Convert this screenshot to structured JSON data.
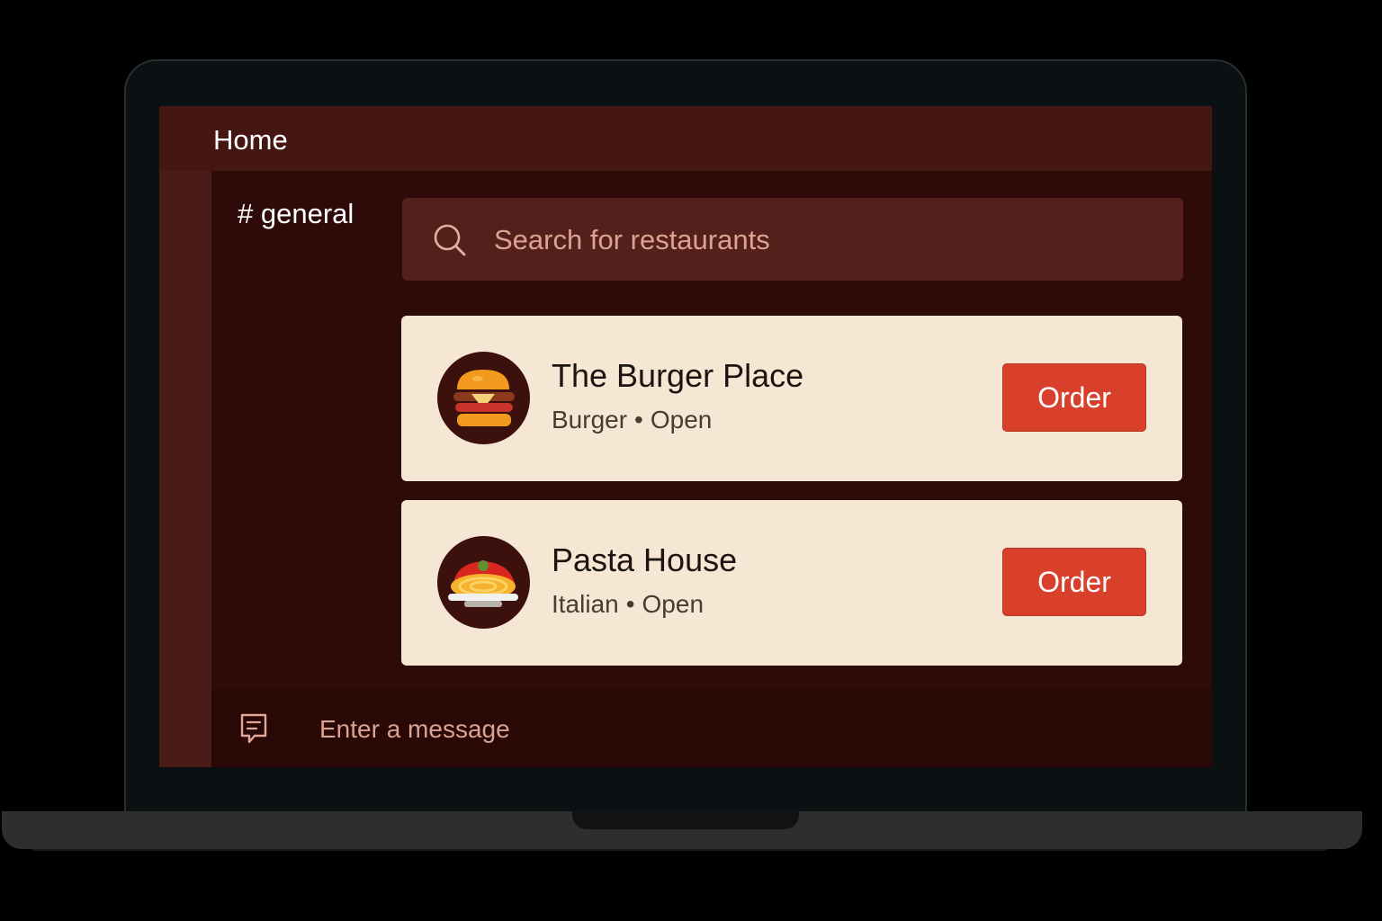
{
  "header": {
    "title": "Home"
  },
  "channel": {
    "label": "# general"
  },
  "search": {
    "placeholder": "Search for restaurants",
    "icon": "search-icon"
  },
  "restaurants": [
    {
      "name": "The Burger Place",
      "category": "Burger",
      "status": "Open",
      "action": "Order",
      "icon": "burger-icon"
    },
    {
      "name": "Pasta House",
      "category": "Italian",
      "status": "Open",
      "action": "Order",
      "icon": "pasta-icon"
    }
  ],
  "composer": {
    "placeholder": "Enter a message",
    "icon": "message-icon"
  },
  "colors": {
    "header_bg": "#451713",
    "app_bg": "#2e0b08",
    "card_bg": "#f6e7d4",
    "accent": "#d8402b"
  }
}
